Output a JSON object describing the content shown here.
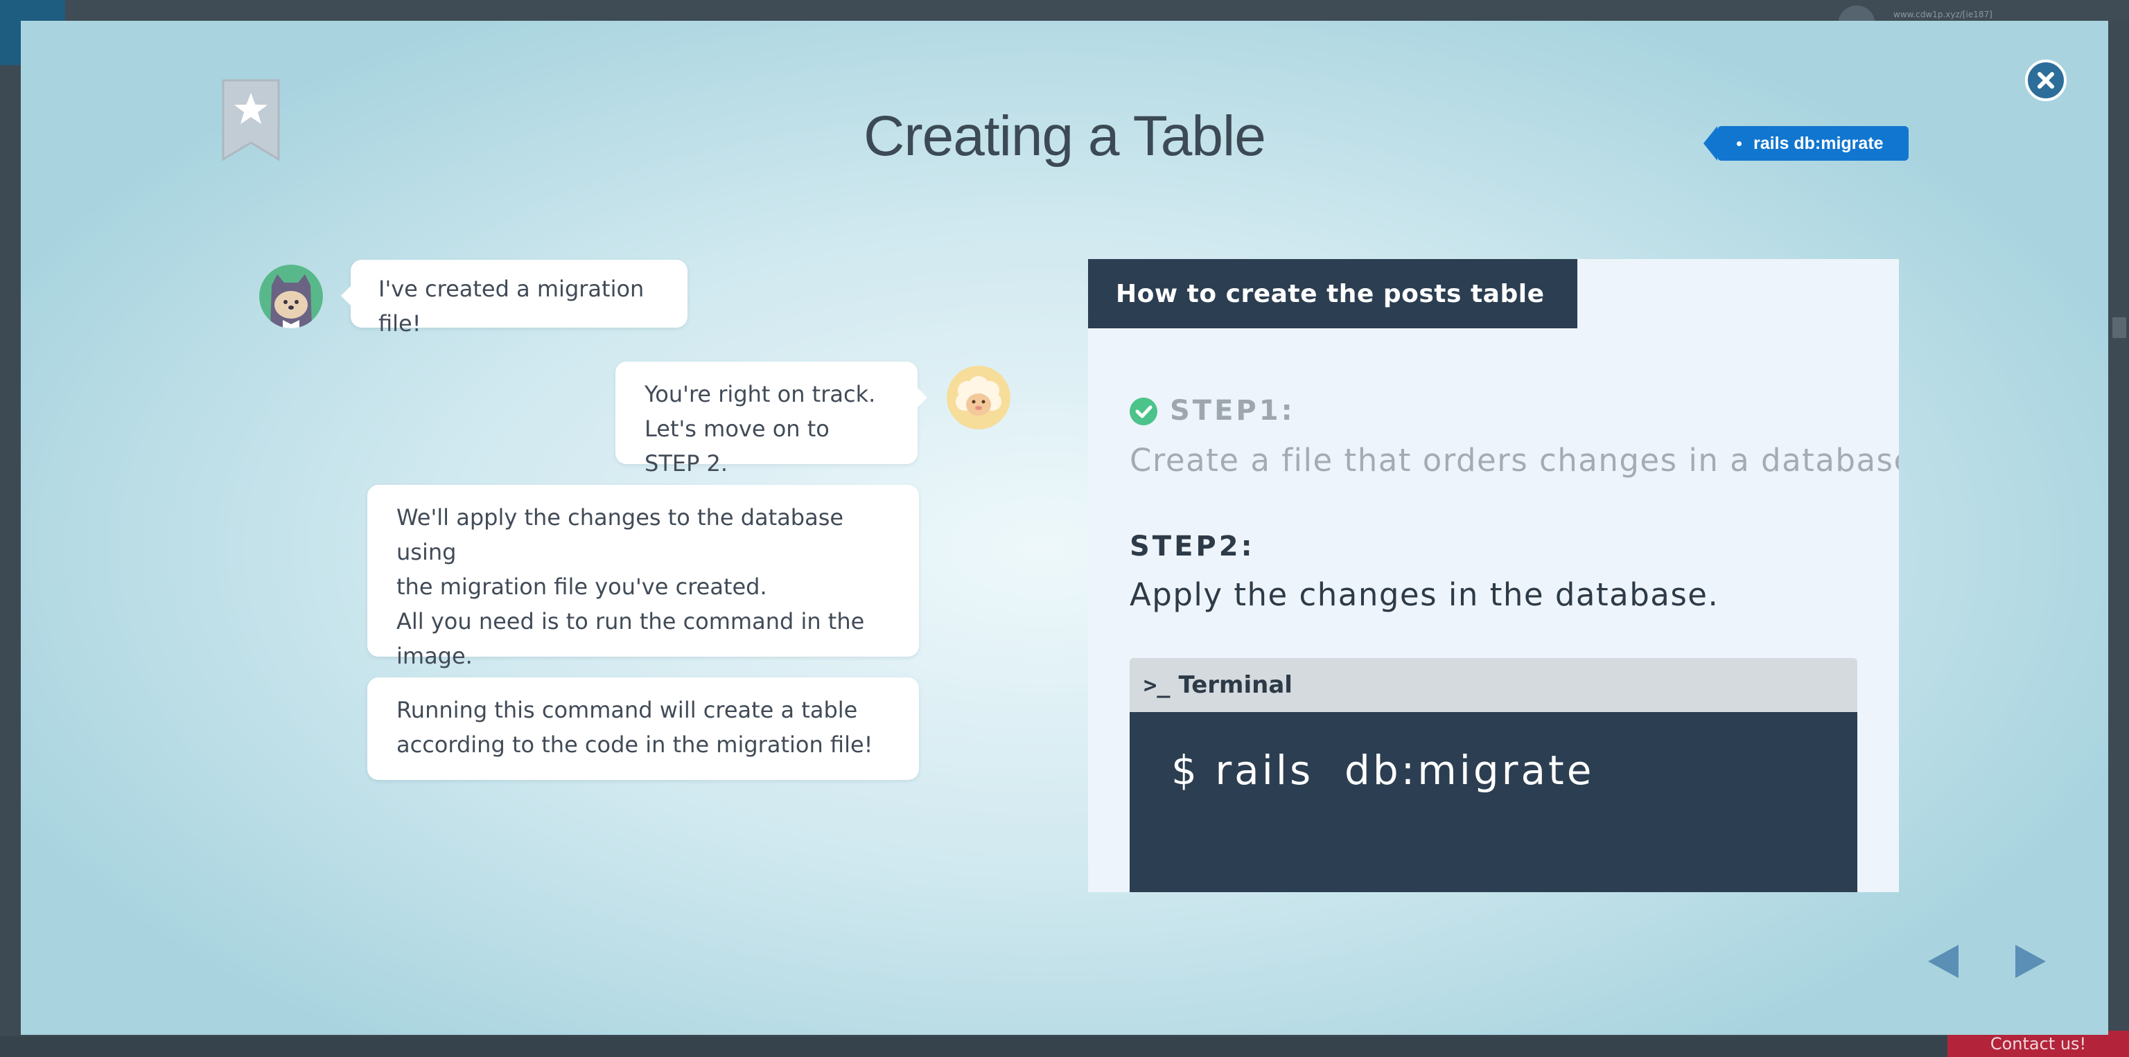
{
  "background": {
    "url_text": "www.cdw1p.xyz/[ie187]",
    "contact_label": "Contact us!"
  },
  "modal": {
    "title": "Creating a Table",
    "tag_label": "rails db:migrate",
    "accent_color": "#1176d0",
    "close_icon": "close-icon",
    "bookmark_icon": "star-bookmark-icon"
  },
  "chat": [
    {
      "speaker": "student",
      "lines": [
        "I've created a migration file!"
      ]
    },
    {
      "speaker": "mentor",
      "lines": [
        "You're right on track.",
        "Let's move on to STEP 2."
      ]
    },
    {
      "speaker": "mentor",
      "lines": [
        "We'll apply the changes to the database using",
        "the migration file you've created.",
        "All you need is to run the command in the",
        "image."
      ]
    },
    {
      "speaker": "mentor",
      "lines": [
        "Running this command will create a table",
        "according to the code in the migration file!"
      ]
    }
  ],
  "slide": {
    "heading": "How to create the posts table",
    "step1_label": "STEP1:",
    "step1_text": "Create a file that orders changes in a database.",
    "step1_done": true,
    "step2_label": "STEP2:",
    "step2_text": "Apply the changes in the database.",
    "terminal_title": "Terminal",
    "terminal_command": "$ rails  db:migrate"
  },
  "navigation": {
    "prev_icon": "triangle-left-icon",
    "next_icon": "triangle-right-icon"
  }
}
